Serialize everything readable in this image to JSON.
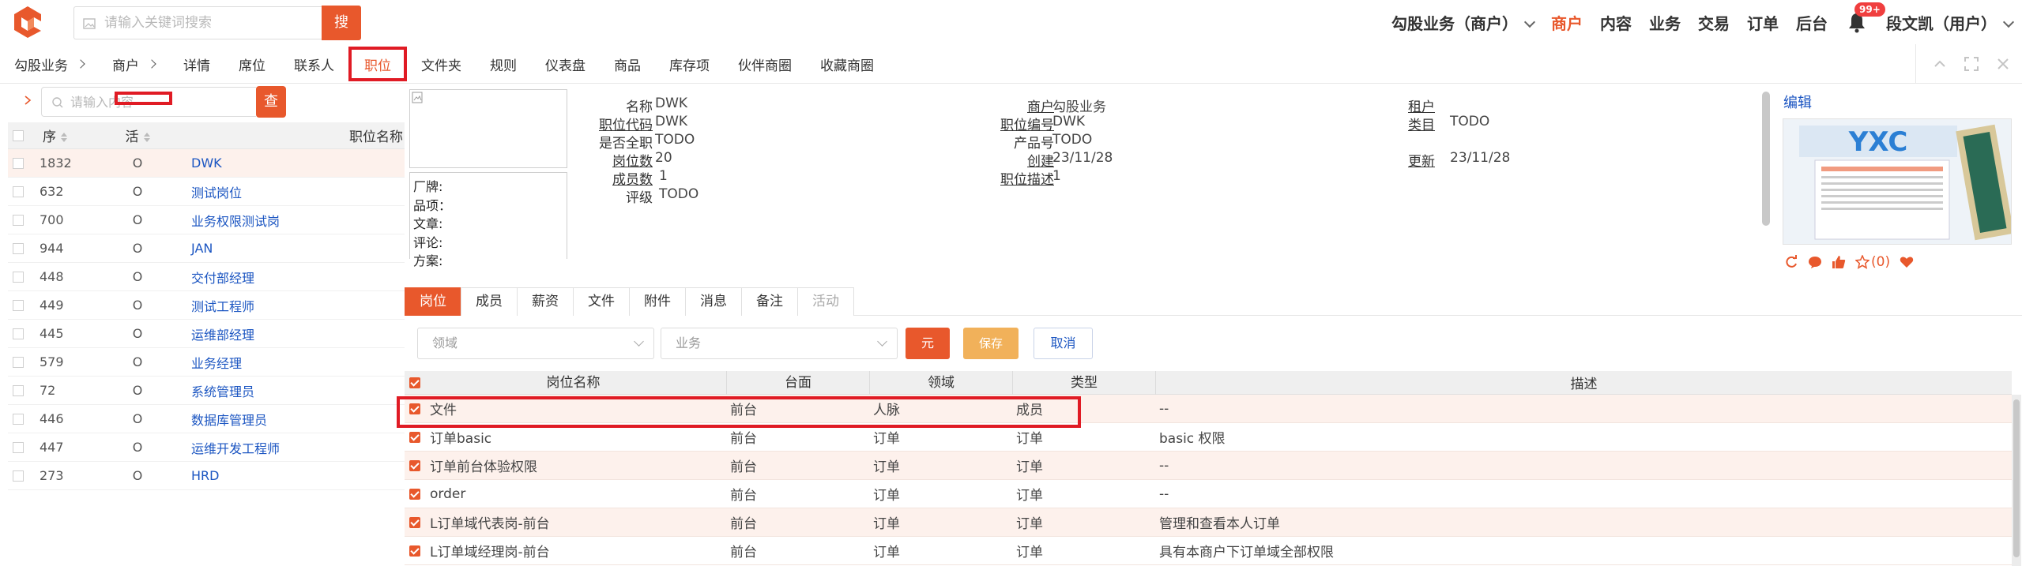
{
  "header": {
    "search_placeholder": "请输入关键词搜索",
    "search_button": "搜",
    "org_switch": "勾股业务（商户）",
    "menu": [
      "商户",
      "内容",
      "业务",
      "交易",
      "订单",
      "后台"
    ],
    "active_menu": "商户",
    "notification_badge": "99+",
    "user": "段文凯（用户）"
  },
  "breadcrumb": [
    "勾股业务",
    "商户",
    "详情",
    "席位",
    "联系人",
    "职位",
    "文件夹",
    "规则",
    "仪表盘",
    "商品",
    "库存项",
    "伙伴商圈",
    "收藏商圈"
  ],
  "active_tab": "职位",
  "left": {
    "search_placeholder": "请输入内容",
    "search_button": "查",
    "columns": [
      "序",
      "活",
      "职位名称"
    ],
    "rows": [
      {
        "seq": "1832",
        "active": "O",
        "name": "DWK"
      },
      {
        "seq": "632",
        "active": "O",
        "name": "测试岗位"
      },
      {
        "seq": "700",
        "active": "O",
        "name": "业务权限测试岗"
      },
      {
        "seq": "944",
        "active": "O",
        "name": "JAN"
      },
      {
        "seq": "448",
        "active": "O",
        "name": "交付部经理"
      },
      {
        "seq": "449",
        "active": "O",
        "name": "测试工程师"
      },
      {
        "seq": "445",
        "active": "O",
        "name": "运维部经理"
      },
      {
        "seq": "579",
        "active": "O",
        "name": "业务经理"
      },
      {
        "seq": "72",
        "active": "O",
        "name": "系统管理员"
      },
      {
        "seq": "446",
        "active": "O",
        "name": "数据库管理员"
      },
      {
        "seq": "447",
        "active": "O",
        "name": "运维开发工程师"
      },
      {
        "seq": "273",
        "active": "O",
        "name": "HRD"
      }
    ]
  },
  "detail": {
    "brand_lines": [
      "厂牌:",
      "品项：",
      "文章:",
      "评论:",
      "方案:"
    ],
    "fields": {
      "name_label": "名称",
      "name_value": "DWK",
      "code_label": "职位代码",
      "code_value": "DWK",
      "fulltime_label": "是否全职",
      "fulltime_value": "TODO",
      "count_label": "岗位数",
      "count_value": "20",
      "members_label": "成员数",
      "members_value": "1",
      "grade_label": "评级",
      "grade_value": "TODO",
      "merchant_label": "商户",
      "merchant_value": "勾股业务",
      "number_label": "职位编号",
      "number_value": "DWK",
      "product_label": "产品号",
      "product_value": "TODO",
      "created_label": "创建",
      "created_value": "23/11/28",
      "desc_label": "职位描述",
      "desc_value": "1",
      "tenant_label": "租户",
      "tenant_value": "",
      "category_label": "类目",
      "category_value": "TODO",
      "updated_label": "更新",
      "updated_value": "23/11/28"
    },
    "edit_label": "编辑",
    "thumb_text": "YXC",
    "favorite_count": "(0)"
  },
  "subtabs": [
    "岗位",
    "成员",
    "薪资",
    "文件",
    "附件",
    "消息",
    "备注",
    "活动"
  ],
  "filters": {
    "domain_placeholder": "领域",
    "business_placeholder": "业务",
    "yuan_button": "元",
    "save_button": "保存",
    "cancel_button": "取消"
  },
  "grid": {
    "columns": [
      "岗位名称",
      "台面",
      "领域",
      "类型",
      "描述"
    ],
    "rows": [
      {
        "name": "文件",
        "plat": "前台",
        "dom": "人脉",
        "type": "成员",
        "desc": "--"
      },
      {
        "name": "订单basic",
        "plat": "前台",
        "dom": "订单",
        "type": "订单",
        "desc": "basic 权限"
      },
      {
        "name": "订单前台体验权限",
        "plat": "前台",
        "dom": "订单",
        "type": "订单",
        "desc": "--"
      },
      {
        "name": "order",
        "plat": "前台",
        "dom": "订单",
        "type": "订单",
        "desc": "--"
      },
      {
        "name": "L订单域代表岗-前台",
        "plat": "前台",
        "dom": "订单",
        "type": "订单",
        "desc": "管理和查看本人订单"
      },
      {
        "name": "L订单域经理岗-前台",
        "plat": "前台",
        "dom": "订单",
        "type": "订单",
        "desc": "具有本商户下订单域全部权限"
      }
    ]
  },
  "colors": {
    "accent": "#e8582c",
    "highlight": "#e01b24",
    "link": "#1c56c2",
    "row_alt": "#fdf1ec"
  }
}
